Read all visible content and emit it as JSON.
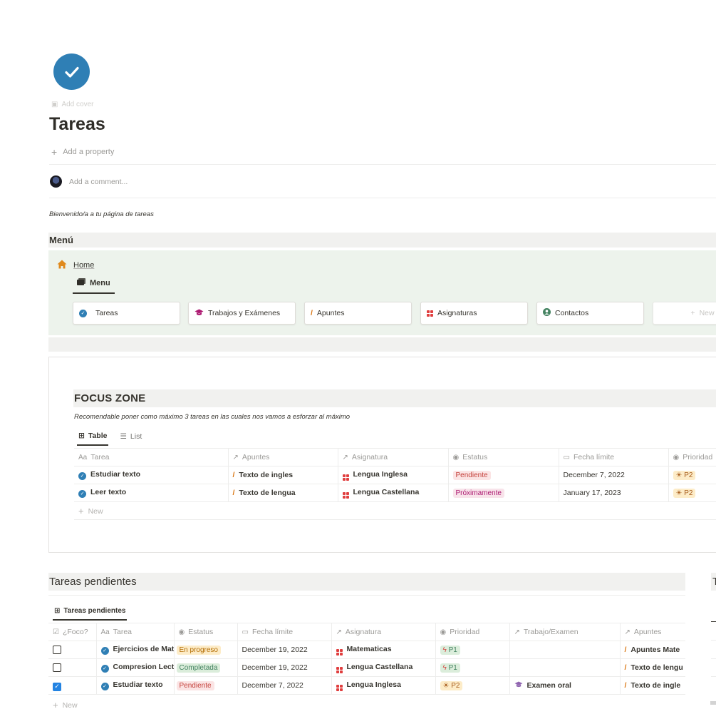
{
  "page": {
    "add_cover": "Add cover",
    "title": "Tareas",
    "add_property": "Add a property",
    "add_comment": "Add a comment...",
    "welcome": "Bienvenido/a a tu página de tareas"
  },
  "menu": {
    "heading": "Menú",
    "home": "Home",
    "tab": "Menu",
    "cards": [
      {
        "label": "Tareas",
        "icon": "check-circle-icon"
      },
      {
        "label": "Trabajos y Exámenes",
        "icon": "graduation-cap-icon"
      },
      {
        "label": "Apuntes",
        "icon": "pencil-icon"
      },
      {
        "label": "Asignaturas",
        "icon": "grid-icon"
      },
      {
        "label": "Contactos",
        "icon": "person-circle-icon"
      }
    ],
    "new_label": "New"
  },
  "focus": {
    "heading": "FOCUS ZONE",
    "subtitle": "Recomendable poner como máximo 3 tareas en las cuales nos vamos a esforzar al máximo",
    "tabs": [
      "Table",
      "List"
    ],
    "columns": [
      "Tarea",
      "Apuntes",
      "Asignatura",
      "Estatus",
      "Fecha límite",
      "Prioridad"
    ],
    "title_prefix": "Aa",
    "rows": [
      {
        "tarea": "Estudiar texto",
        "apuntes": "Texto de ingles",
        "asignatura": "Lengua Inglesa",
        "estatus": "Pendiente",
        "fecha": "December 7, 2022",
        "prioridad": "P2"
      },
      {
        "tarea": "Leer texto",
        "apuntes": "Texto de lengua",
        "asignatura": "Lengua Castellana",
        "estatus": "Próximamente",
        "fecha": "January 17, 2023",
        "prioridad": "P2"
      }
    ],
    "new_label": "New"
  },
  "pending": {
    "heading": "Tareas pendientes",
    "tab": "Tareas pendientes",
    "right_heading_letter": "T",
    "columns": [
      "¿Foco?",
      "Tarea",
      "Estatus",
      "Fecha límite",
      "Asignatura",
      "Prioridad",
      "Trabajo/Examen",
      "Apuntes"
    ],
    "title_prefix": "Aa",
    "rows": [
      {
        "foco": false,
        "tarea": "Ejercicios de Mat",
        "estatus": "En progreso",
        "fecha": "December 19, 2022",
        "asignatura": "Matematicas",
        "prioridad": "P1",
        "trabajo": "",
        "apuntes": "Apuntes Mate"
      },
      {
        "foco": false,
        "tarea": "Compresion Lect",
        "estatus": "Completada",
        "fecha": "December 19, 2022",
        "asignatura": "Lengua Castellana",
        "prioridad": "P1",
        "trabajo": "",
        "apuntes": "Texto de lengu"
      },
      {
        "foco": true,
        "tarea": "Estudiar texto",
        "estatus": "Pendiente",
        "fecha": "December 7, 2022",
        "asignatura": "Lengua Inglesa",
        "prioridad": "P2",
        "trabajo": "Examen oral",
        "apuntes": "Texto de ingle"
      }
    ],
    "new_label": "New"
  },
  "colors": {
    "accent_blue": "#2f7fb5",
    "menu_bg": "#edf3ec",
    "heading_bg": "#f1f1ef"
  }
}
